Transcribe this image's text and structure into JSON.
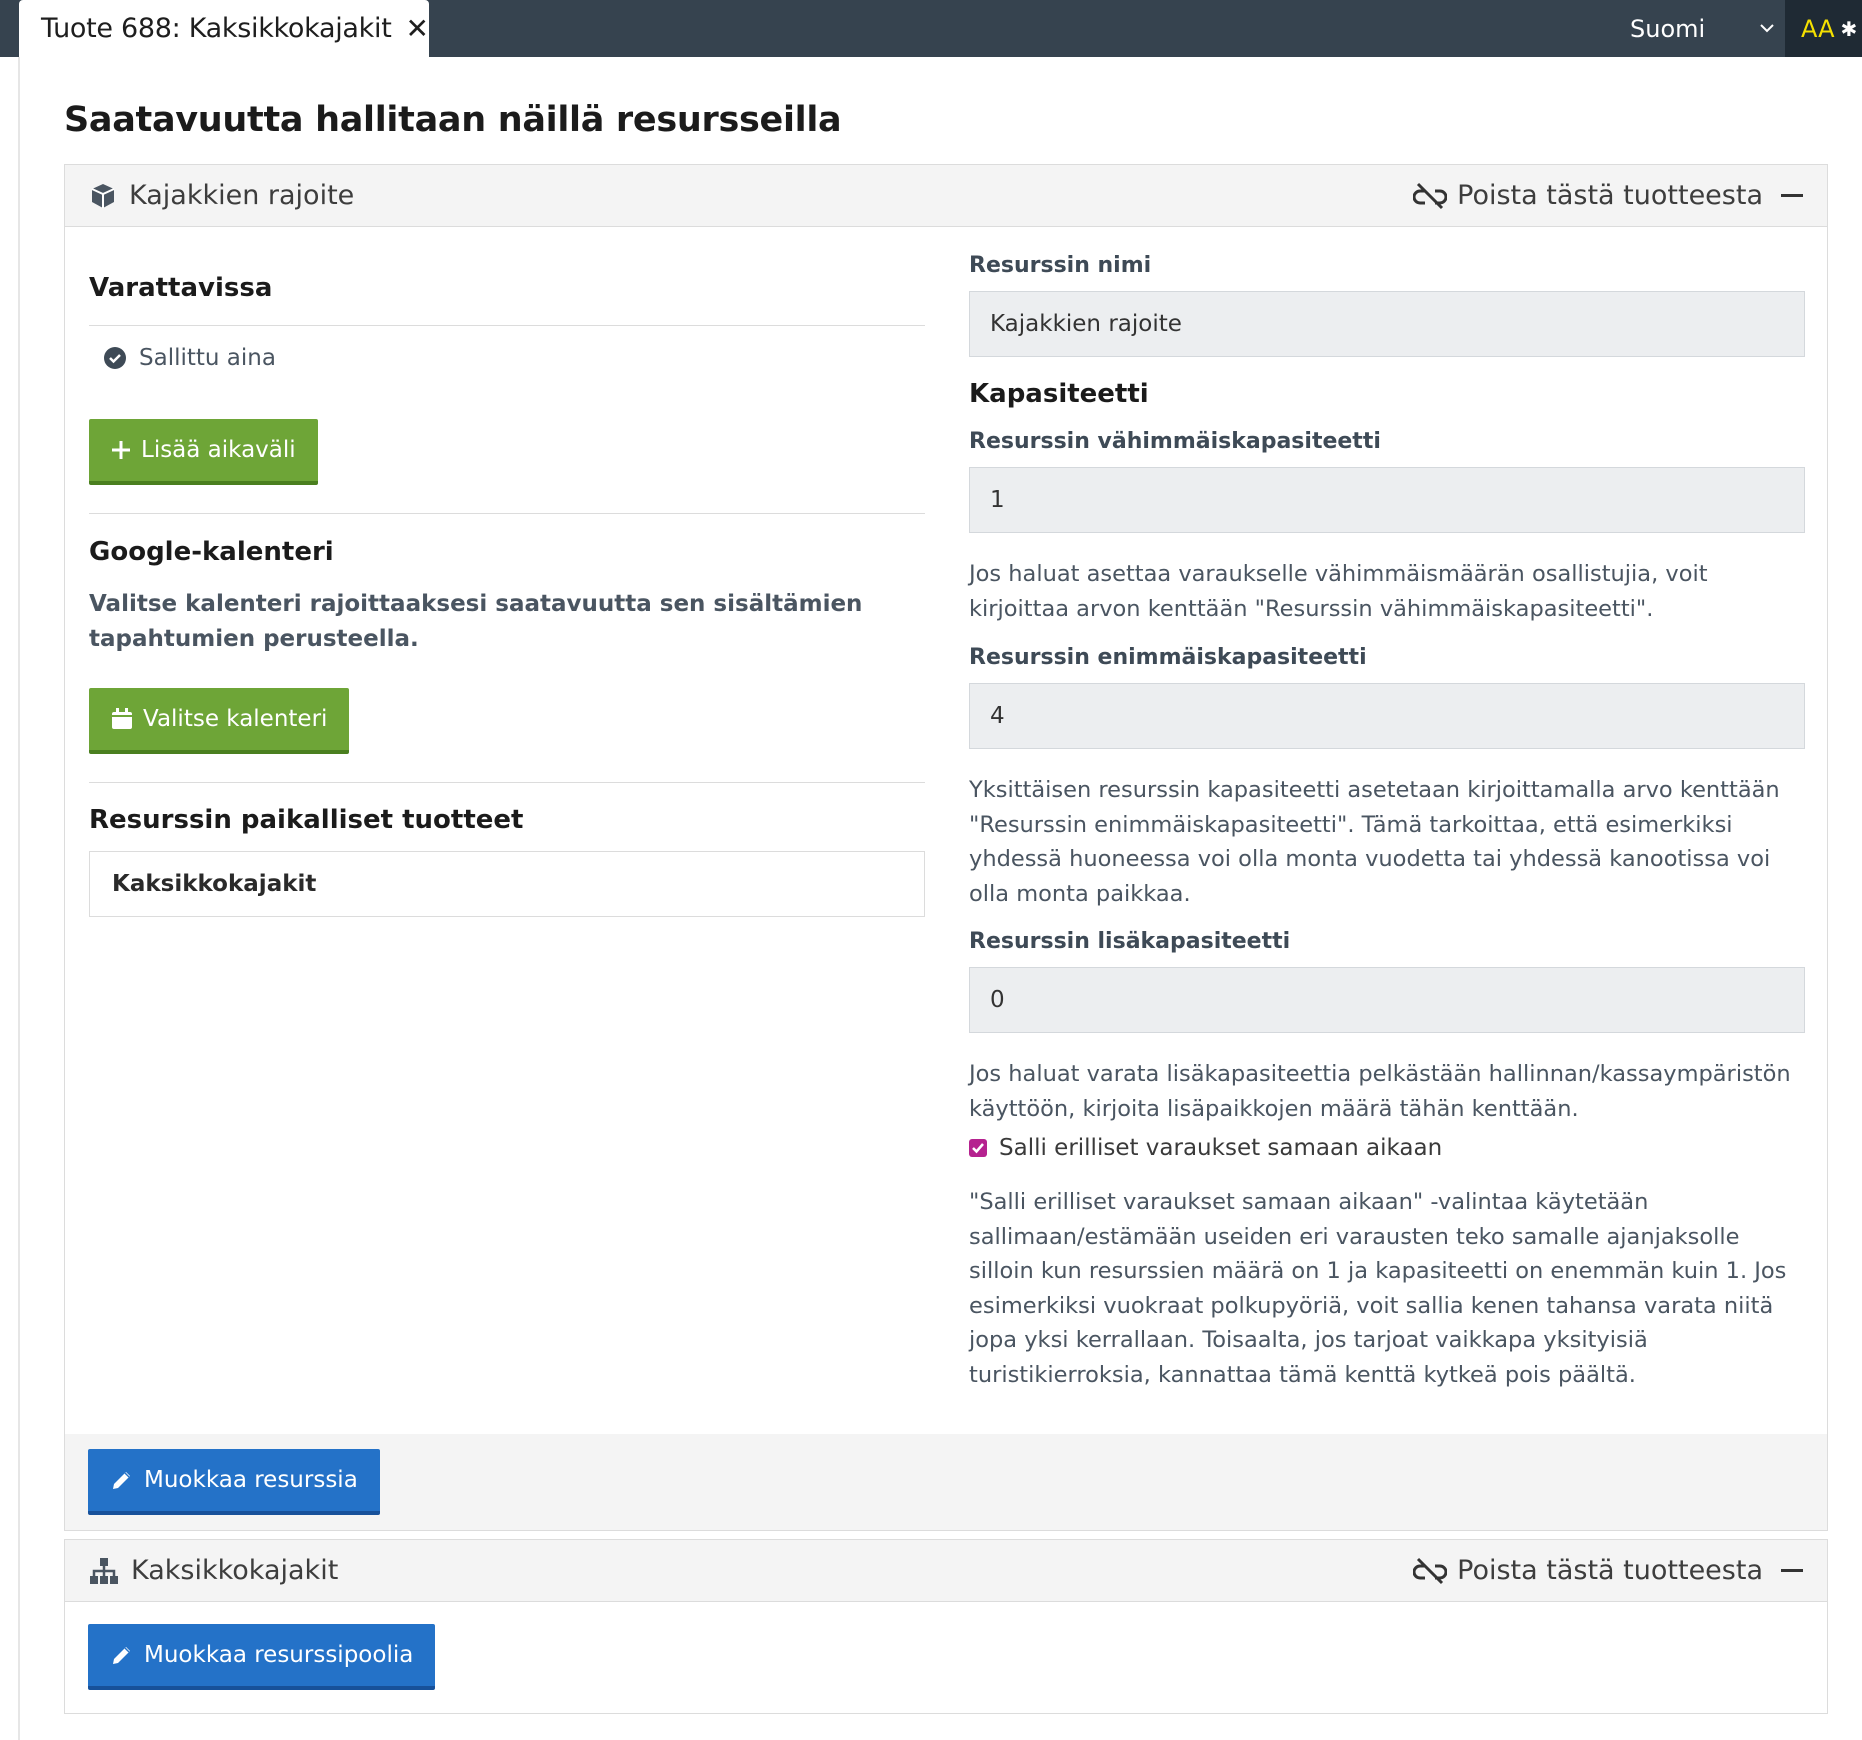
{
  "tab": {
    "title": "Tuote 688: Kaksikkokajakit",
    "close": "✕"
  },
  "header": {
    "language": "Suomi",
    "accessibility": "AA"
  },
  "page": {
    "title": "Saatavuutta hallitaan näillä resursseilla"
  },
  "resource": {
    "title": "Kajakkien rajoite",
    "remove_label": "Poista tästä tuotteesta",
    "availability": {
      "heading": "Varattavissa",
      "status": "Sallittu aina",
      "add_interval_label": "Lisää aikaväli"
    },
    "google": {
      "heading": "Google-kalenteri",
      "description": "Valitse kalenteri rajoittaaksesi saatavuutta sen sisältämien tapahtumien perusteella.",
      "select_label": "Valitse kalenteri"
    },
    "local_products": {
      "heading": "Resurssin paikalliset tuotteet",
      "items": [
        "Kaksikkokajakit"
      ]
    },
    "name_label": "Resurssin nimi",
    "name_value": "Kajakkien rajoite",
    "capacity_heading": "Kapasiteetti",
    "min_label": "Resurssin vähimmäiskapasiteetti",
    "min_value": "1",
    "min_help": "Jos haluat asettaa varaukselle vähimmäismäärän osallistujia, voit kirjoittaa arvon kenttään \"Resurssin vähimmäiskapasiteetti\".",
    "max_label": "Resurssin enimmäiskapasiteetti",
    "max_value": "4",
    "max_help": "Yksittäisen resurssin kapasiteetti asetetaan kirjoittamalla arvo kenttään \"Resurssin enimmäiskapasiteetti\". Tämä tarkoittaa, että esimerkiksi yhdessä huoneessa voi olla monta vuodetta tai yhdessä kanootissa voi olla monta paikkaa.",
    "extra_label": "Resurssin lisäkapasiteetti",
    "extra_value": "0",
    "extra_help": "Jos haluat varata lisäkapasiteettia pelkästään hallinnan/kassaympäristön käyttöön, kirjoita lisäpaikkojen määrä tähän kenttään.",
    "concurrent_label": "Salli erilliset varaukset samaan aikaan",
    "concurrent_checked": true,
    "concurrent_help": "\"Salli erilliset varaukset samaan aikaan\" -valintaa käytetään sallimaan/estämään useiden eri varausten teko samalle ajanjaksolle silloin kun resurssien määrä on 1 ja kapasiteetti on enemmän kuin 1. Jos esimerkiksi vuokraat polkupyöriä, voit sallia kenen tahansa varata niitä jopa yksi kerrallaan. Toisaalta, jos tarjoat vaikkapa yksityisiä turistikierroksia, kannattaa tämä kenttä kytkeä pois päältä.",
    "edit_label": "Muokkaa resurssia"
  },
  "pool": {
    "title": "Kaksikkokajakit",
    "remove_label": "Poista tästä tuotteesta",
    "edit_label": "Muokkaa resurssipoolia"
  },
  "colors": {
    "green": "#6ea537",
    "blue": "#2472c8",
    "topbar": "#36434f",
    "checkbox": "#b5228f"
  }
}
